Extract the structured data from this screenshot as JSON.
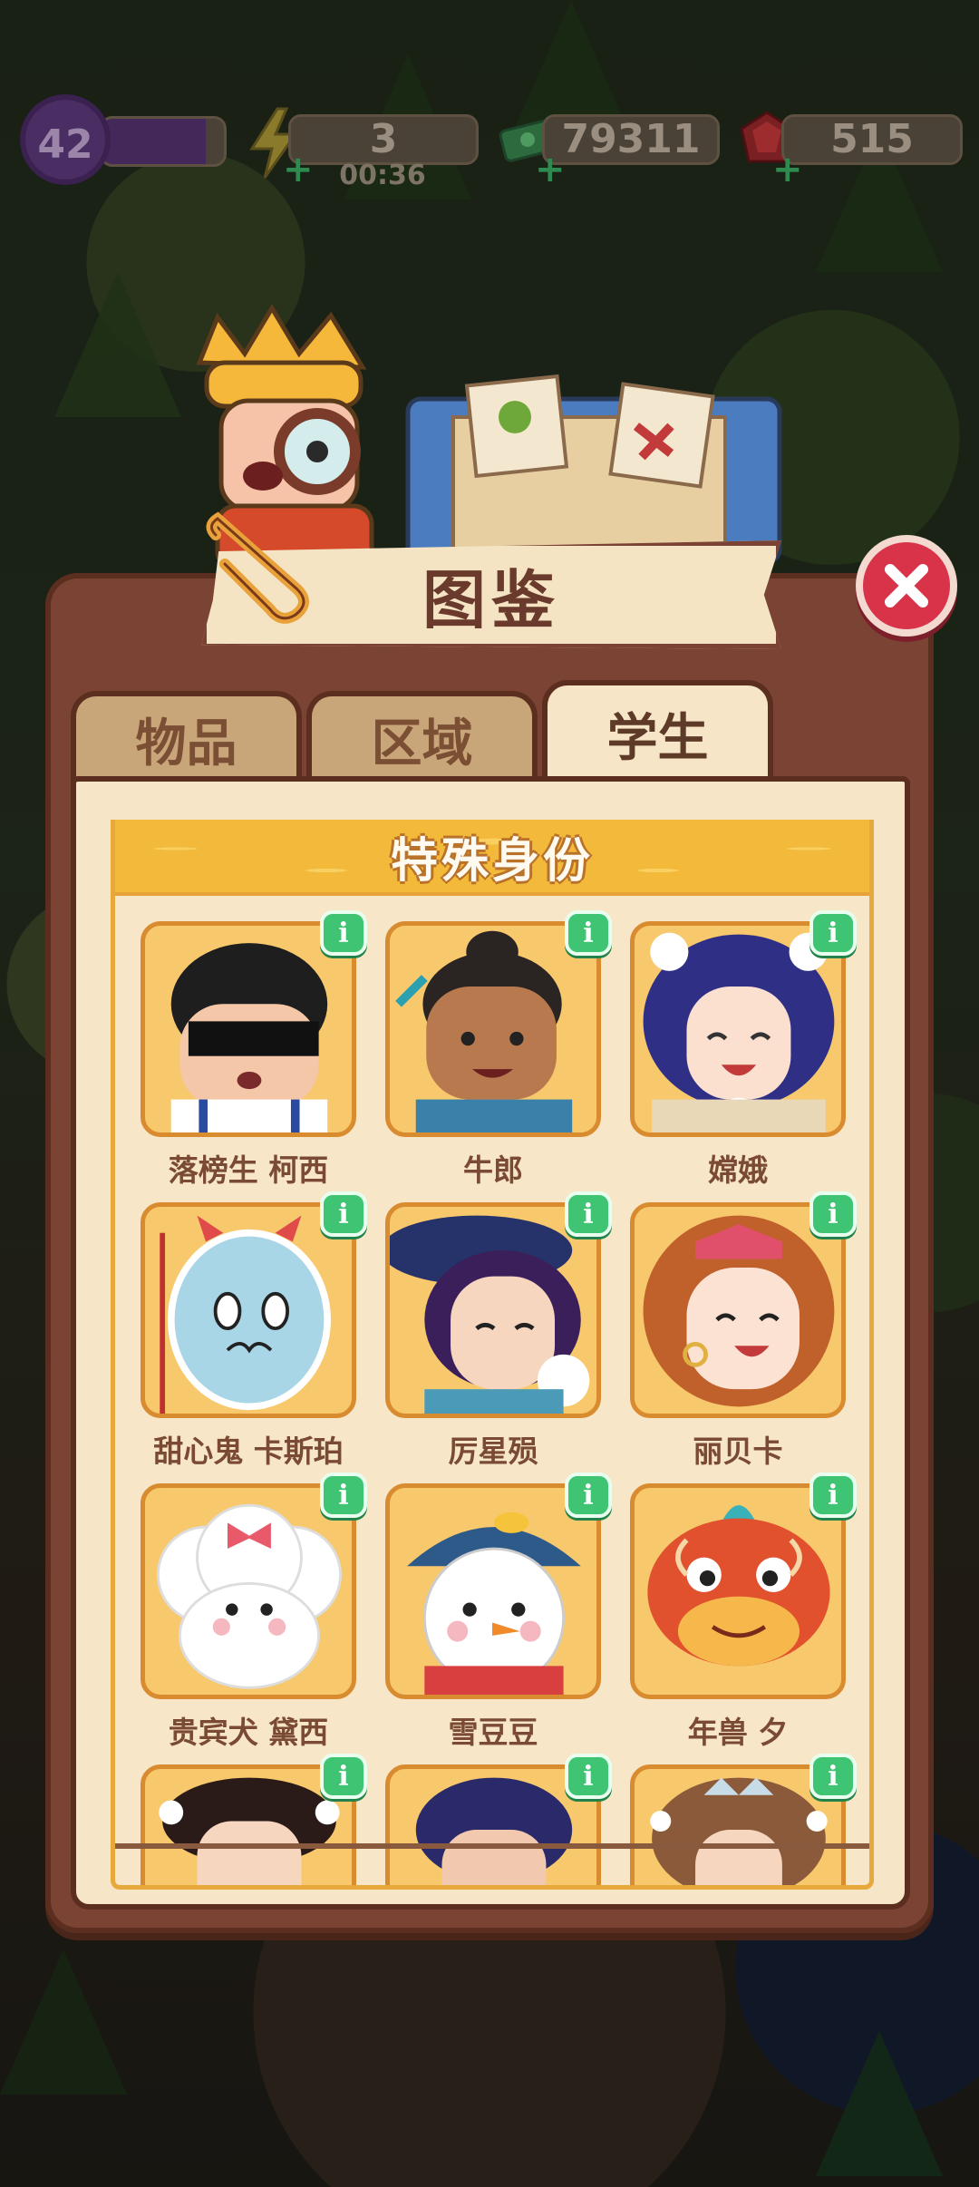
{
  "hud": {
    "level": "42",
    "level_progress": 0.85,
    "energy": "3",
    "energy_timer": "00:36",
    "cash": "79311",
    "gems": "515"
  },
  "dialog": {
    "title": "图鉴",
    "close_icon": "close-icon",
    "tabs": [
      {
        "label": "物品",
        "active": false
      },
      {
        "label": "区域",
        "active": false
      },
      {
        "label": "学生",
        "active": true
      }
    ],
    "section_title": "特殊身份",
    "info_icon_label": "i",
    "cards": [
      {
        "name": "落榜生 柯西",
        "avatar": "student-glasses-bar"
      },
      {
        "name": "牛郎",
        "avatar": "cowherd"
      },
      {
        "name": "嫦娥",
        "avatar": "change-moon-goddess"
      },
      {
        "name": "甜心鬼 卡斯珀",
        "avatar": "ghost"
      },
      {
        "name": "厉星殒",
        "avatar": "witch-hat-lady"
      },
      {
        "name": "丽贝卡",
        "avatar": "red-hair-girl"
      },
      {
        "name": "贵宾犬 黛西",
        "avatar": "poodle"
      },
      {
        "name": "雪豆豆",
        "avatar": "snowman"
      },
      {
        "name": "年兽 夕",
        "avatar": "nian-beast"
      },
      {
        "name": "",
        "avatar": "partial-1"
      },
      {
        "name": "",
        "avatar": "partial-2"
      },
      {
        "name": "",
        "avatar": "partial-3"
      }
    ]
  },
  "colors": {
    "modal": "#7a4334",
    "panel": "#f6e5c6",
    "section_header": "#f3b93a",
    "info_badge": "#3fc474",
    "close_button": "#d9334a"
  }
}
